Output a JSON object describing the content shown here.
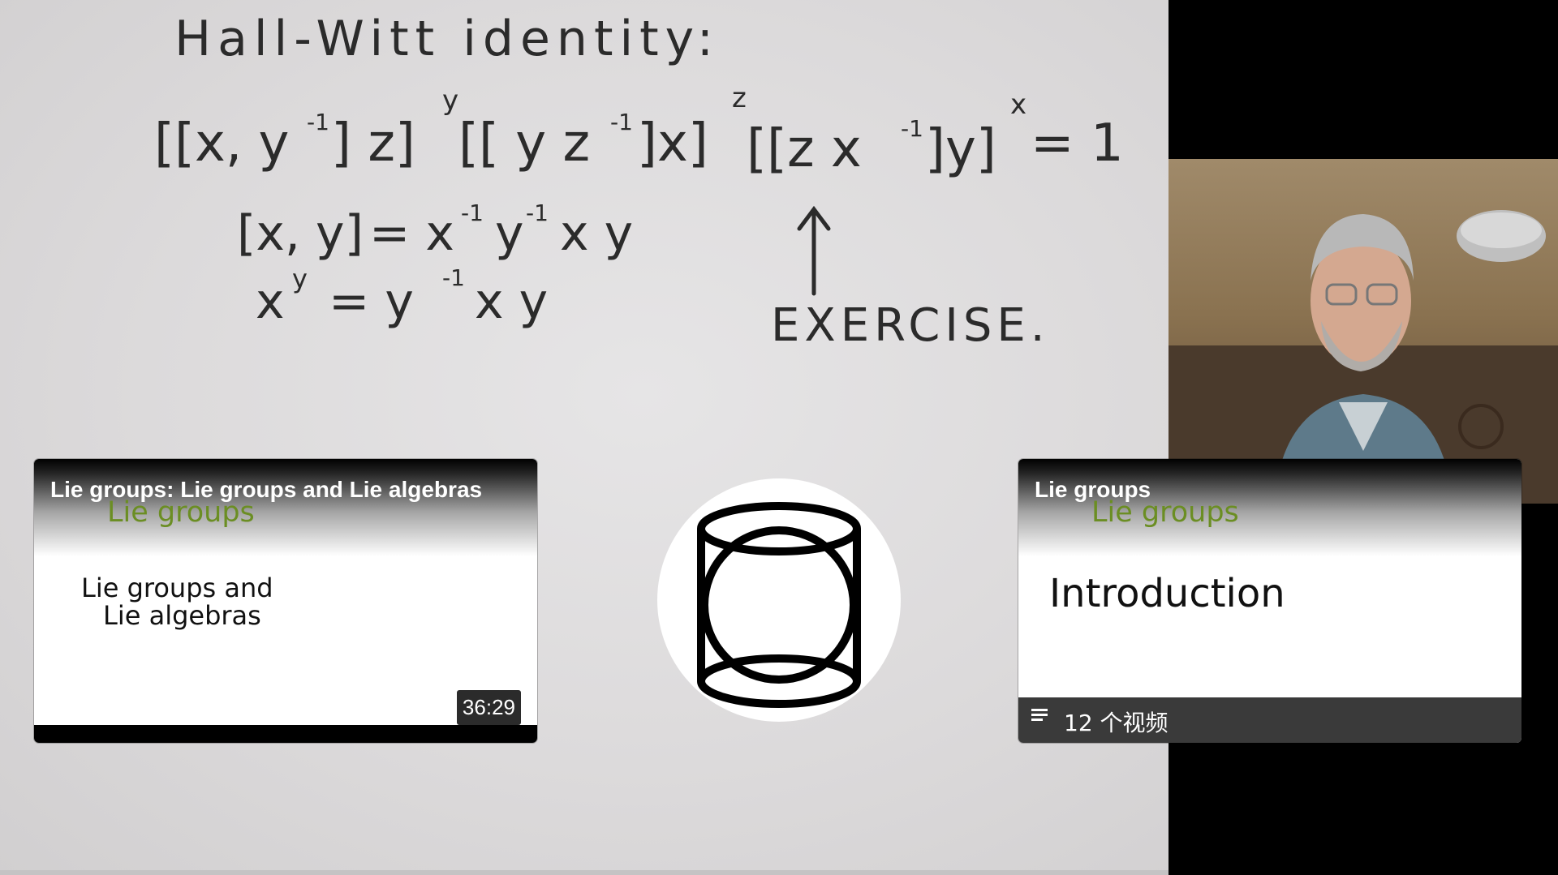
{
  "whiteboard": {
    "heading": "Hall-Witt identity:",
    "identity_parts": {
      "open1": "[[x, y",
      "inv1": "-1",
      "close1": "] z]",
      "sup1": "y",
      "open2": "[[ y z",
      "inv2": "-1",
      "close2": "]x]",
      "sup2": "z",
      "open3": "[[z x",
      "inv3": "-1",
      "close3": "]y]",
      "sup3": "x",
      "equals_one": "= 1"
    },
    "commutator_lhs": "[x, y]",
    "commutator_eq": "= x",
    "commutator_inv1": "-1",
    "commutator_mid": "y",
    "commutator_inv2": "-1",
    "commutator_tail": "x y",
    "conjugate_base": "x",
    "conjugate_sup": "y",
    "conjugate_eq": "= y",
    "conjugate_inv": "-1",
    "conjugate_tail": "x y",
    "exercise_label": "EXERCISE."
  },
  "webcam": {
    "icon": "presenter-video"
  },
  "video_card": {
    "title": "Lie groups: Lie groups and Lie algebras",
    "series_label": "Lie groups",
    "slide_line1": "Lie groups and",
    "slide_line2": "Lie algebras",
    "duration": "36:29"
  },
  "channel_avatar": {
    "icon": "cylinder-sphere-logo"
  },
  "playlist_card": {
    "title": "Lie groups",
    "series_label": "Lie groups",
    "slide_text": "Introduction",
    "playlist_icon": "playlist-icon",
    "video_count": "12 个视频"
  },
  "colors": {
    "series_green": "#6b8e23",
    "ink": "#2b2b2b"
  }
}
